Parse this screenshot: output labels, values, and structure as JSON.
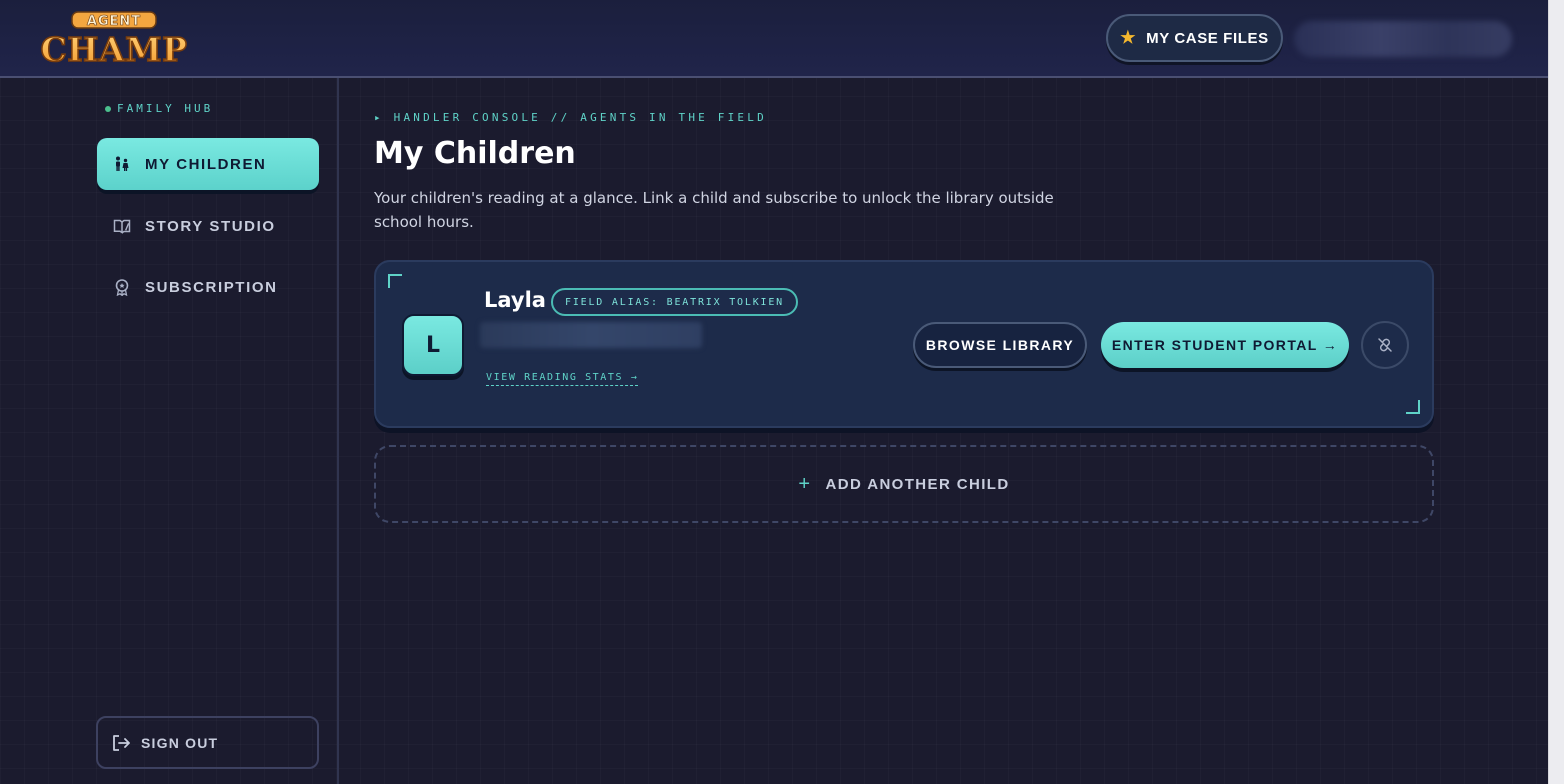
{
  "header": {
    "logo_top": "AGENT",
    "logo_bottom": "CHAMP",
    "case_files_label": "MY CASE FILES"
  },
  "sidebar": {
    "section_label": "FAMILY HUB",
    "items": [
      {
        "label": "MY CHILDREN",
        "icon": "family-icon",
        "active": true
      },
      {
        "label": "STORY STUDIO",
        "icon": "book-pen-icon",
        "active": false
      },
      {
        "label": "SUBSCRIPTION",
        "icon": "badge-icon",
        "active": false
      }
    ],
    "sign_out_label": "SIGN OUT"
  },
  "main": {
    "breadcrumb": "▸ HANDLER CONSOLE // AGENTS IN THE FIELD",
    "title": "My Children",
    "description": "Your children's reading at a glance. Link a child and subscribe to unlock the library outside school hours.",
    "children": [
      {
        "initial": "L",
        "name": "Layla",
        "alias": "FIELD ALIAS: BEATRIX TOLKIEN",
        "stats_link": "VIEW READING STATS →",
        "browse_label": "BROWSE LIBRARY",
        "portal_label": "ENTER STUDENT PORTAL →"
      }
    ],
    "add_child_label": "ADD ANOTHER CHILD"
  },
  "colors": {
    "accent": "#5fd3c8",
    "background": "#1b1b2e",
    "card": "#1d2b4a",
    "star": "#f5b82e"
  }
}
